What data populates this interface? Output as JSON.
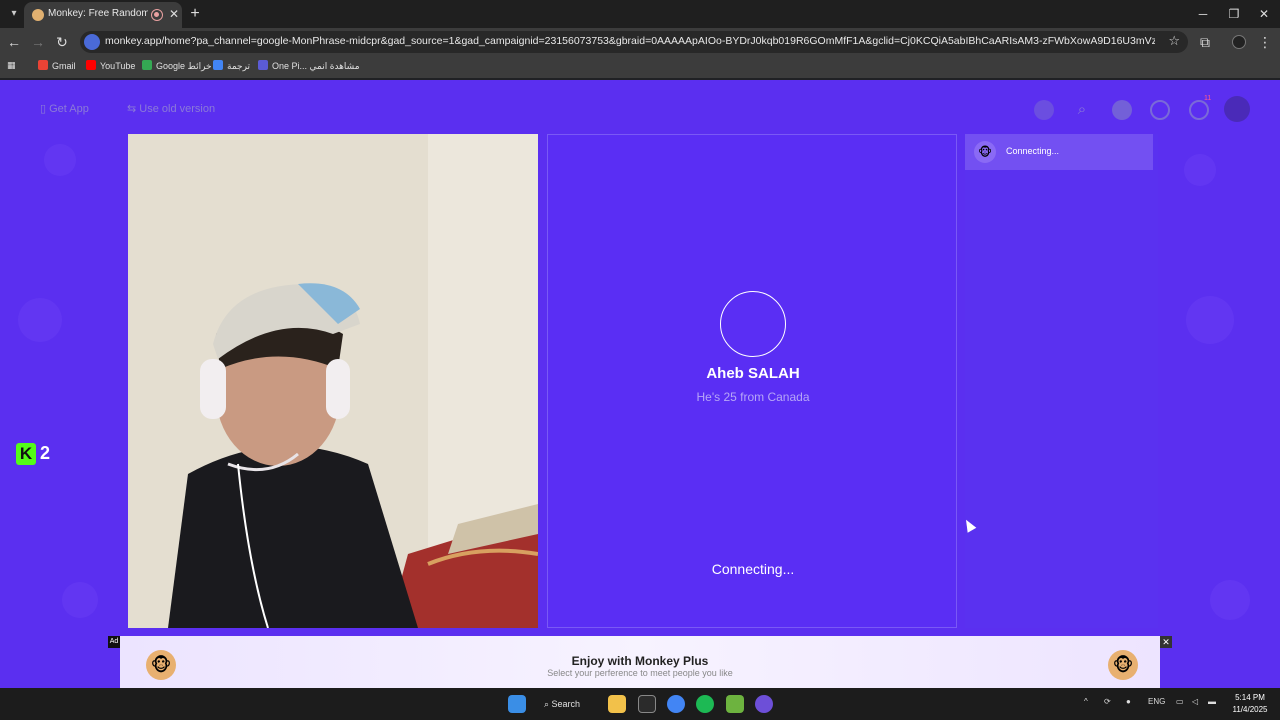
{
  "browser": {
    "tab_title": "Monkey: Free Random Vide",
    "url": "monkey.app/home?pa_channel=google-MonPhrase-midcpr&gad_source=1&gad_campaignid=23156073753&gbraid=0AAAAApAIOo-BYDrJ0kqb019R6GOmMfF1A&gclid=Cj0KCQiA5abIBhCaARIsAM3-zFWbXowA9D16U3mVzuv4bPjYPux8AxLlFY3IfSzs9ZO...",
    "bookmarks": [
      "Gmail",
      "YouTube",
      "Google خرائط",
      "ترجمة",
      "One Pi... مشاهدة انمي"
    ]
  },
  "app": {
    "get_app": "Get App",
    "old_version": "Use old version",
    "notification_count": "11"
  },
  "peer": {
    "name": "Aheb SALAH",
    "subtitle": "He's 25 from Canada",
    "status": "Connecting..."
  },
  "chat": {
    "item_label": "Connecting..."
  },
  "badge": {
    "letter": "K",
    "count": "2"
  },
  "ad": {
    "tag": "Ad",
    "headline": "Enjoy with Monkey Plus",
    "subtext": "Select your perference to meet people you like"
  },
  "taskbar": {
    "search": "Search",
    "lang": "ENG",
    "time": "5:14 PM",
    "date": "11/4/2025"
  },
  "colors": {
    "page_bg": "#5b2ff0",
    "accent": "#53fc18"
  }
}
